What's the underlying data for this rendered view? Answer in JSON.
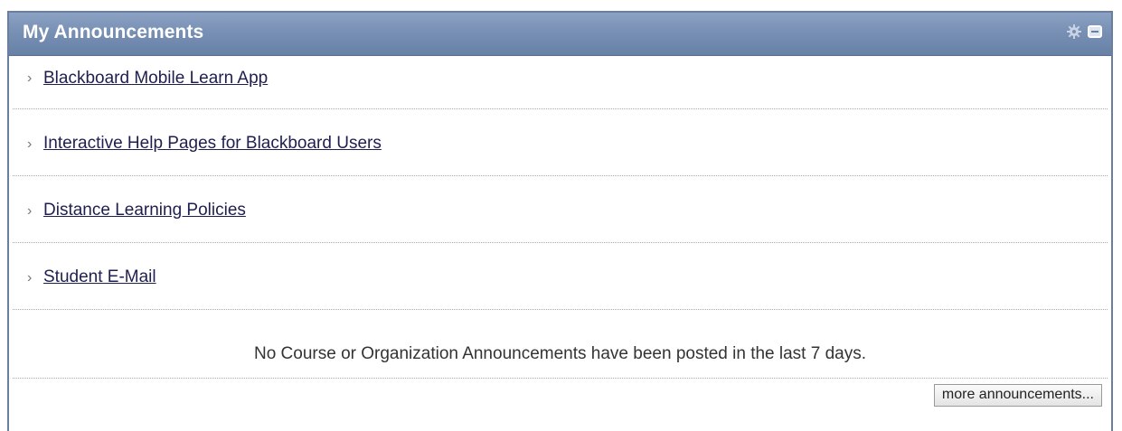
{
  "module": {
    "title": "My Announcements",
    "icons": [
      "gear-icon",
      "minimize-icon"
    ]
  },
  "announcements": [
    {
      "label": "Blackboard Mobile Learn App"
    },
    {
      "label": "Interactive Help Pages for Blackboard Users"
    },
    {
      "label": "Distance Learning Policies"
    },
    {
      "label": "Student E-Mail"
    }
  ],
  "notice": "No Course or Organization Announcements have been posted in the last 7 days.",
  "footer": {
    "more_label": "more announcements..."
  },
  "colors": {
    "header": "#7890b4",
    "border": "#6a7f9d",
    "link": "#1f1f4f"
  }
}
